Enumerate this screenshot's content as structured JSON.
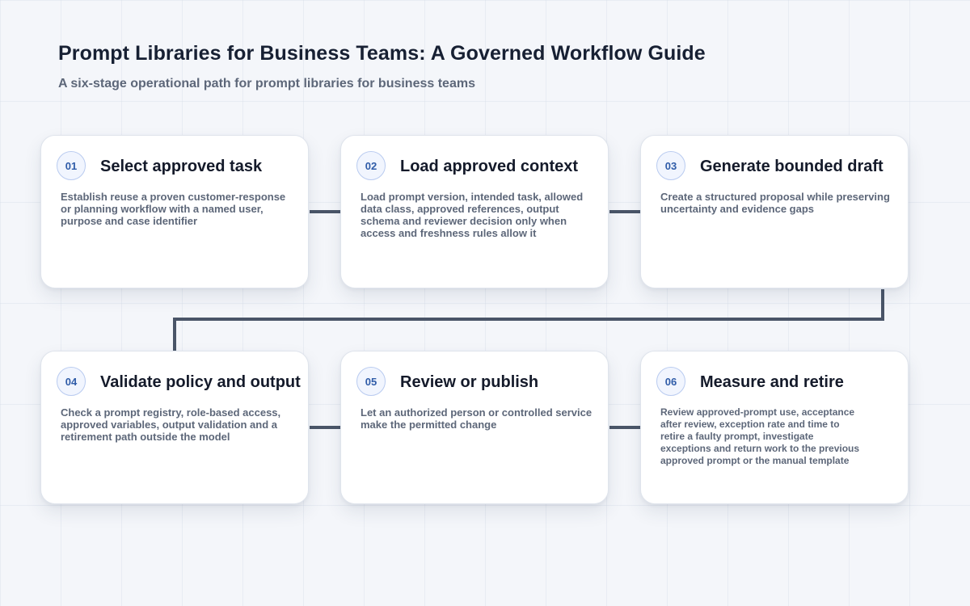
{
  "header": {
    "title": "Prompt Libraries for Business Teams: A Governed Workflow Guide",
    "subtitle": "A six-stage operational path for prompt libraries for business teams"
  },
  "colors": {
    "connector": "#4a5568",
    "badge_text": "#2f5ca8",
    "badge_border": "#b9cbf0"
  },
  "steps": [
    {
      "number": "01",
      "title": "Select approved task",
      "description": "Establish reuse a proven customer-response or planning workflow with a named user, purpose and case identifier"
    },
    {
      "number": "02",
      "title": "Load approved context",
      "description": "Load prompt version, intended task, allowed data class, approved references, output schema and reviewer decision only when access and freshness rules allow it"
    },
    {
      "number": "03",
      "title": "Generate bounded draft",
      "description": "Create a structured proposal while preserving uncertainty and evidence gaps"
    },
    {
      "number": "04",
      "title": "Validate policy and output",
      "description": "Check a prompt registry, role-based access, approved variables, output validation and a retirement path outside the model"
    },
    {
      "number": "05",
      "title": "Review or publish",
      "description": "Let an authorized person or controlled service make the permitted change"
    },
    {
      "number": "06",
      "title": "Measure and retire",
      "description": "Review approved-prompt use, acceptance after review, exception rate and time to retire a faulty prompt, investigate exceptions and return work to the previous approved prompt or the manual template"
    }
  ]
}
